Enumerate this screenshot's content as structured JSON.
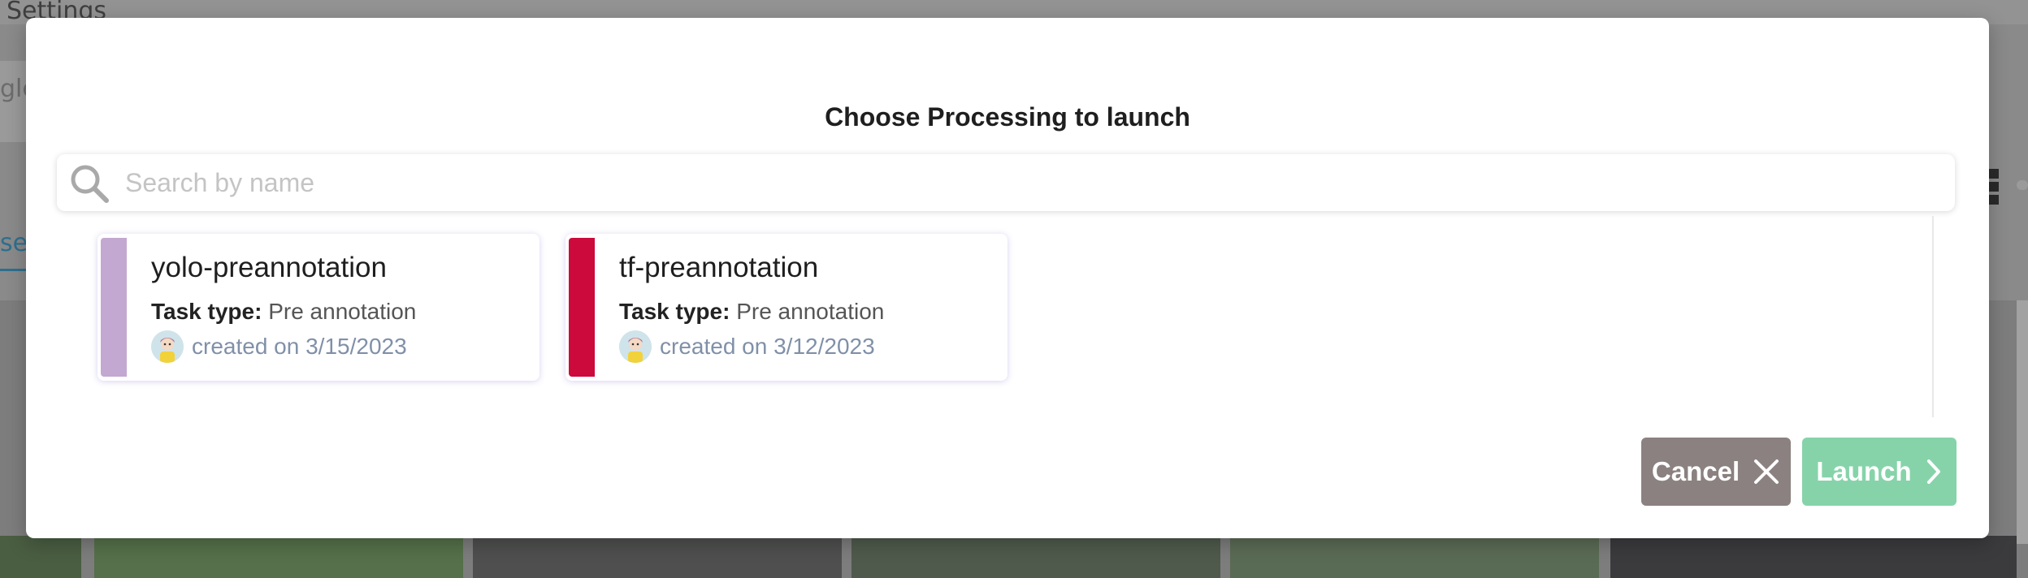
{
  "background": {
    "page_title": "Settings",
    "search_fragment": "gle",
    "tab_fragment": "set"
  },
  "modal": {
    "title": "Choose Processing to launch",
    "search": {
      "placeholder": "Search by name",
      "value": ""
    },
    "cards": [
      {
        "name": "yolo-preannotation",
        "task_type_label": "Task type:",
        "task_type": "Pre annotation",
        "created": "created on 3/15/2023",
        "color": "#c3a8d1"
      },
      {
        "name": "tf-preannotation",
        "task_type_label": "Task type:",
        "task_type": "Pre annotation",
        "created": "created on 3/12/2023",
        "color": "#cc0a3c"
      }
    ],
    "buttons": {
      "cancel_label": "Cancel",
      "launch_label": "Launch"
    }
  },
  "colors": {
    "cancel": "#8a8180",
    "launch": "#86d3aa",
    "overlay": "#8a8a8a"
  }
}
